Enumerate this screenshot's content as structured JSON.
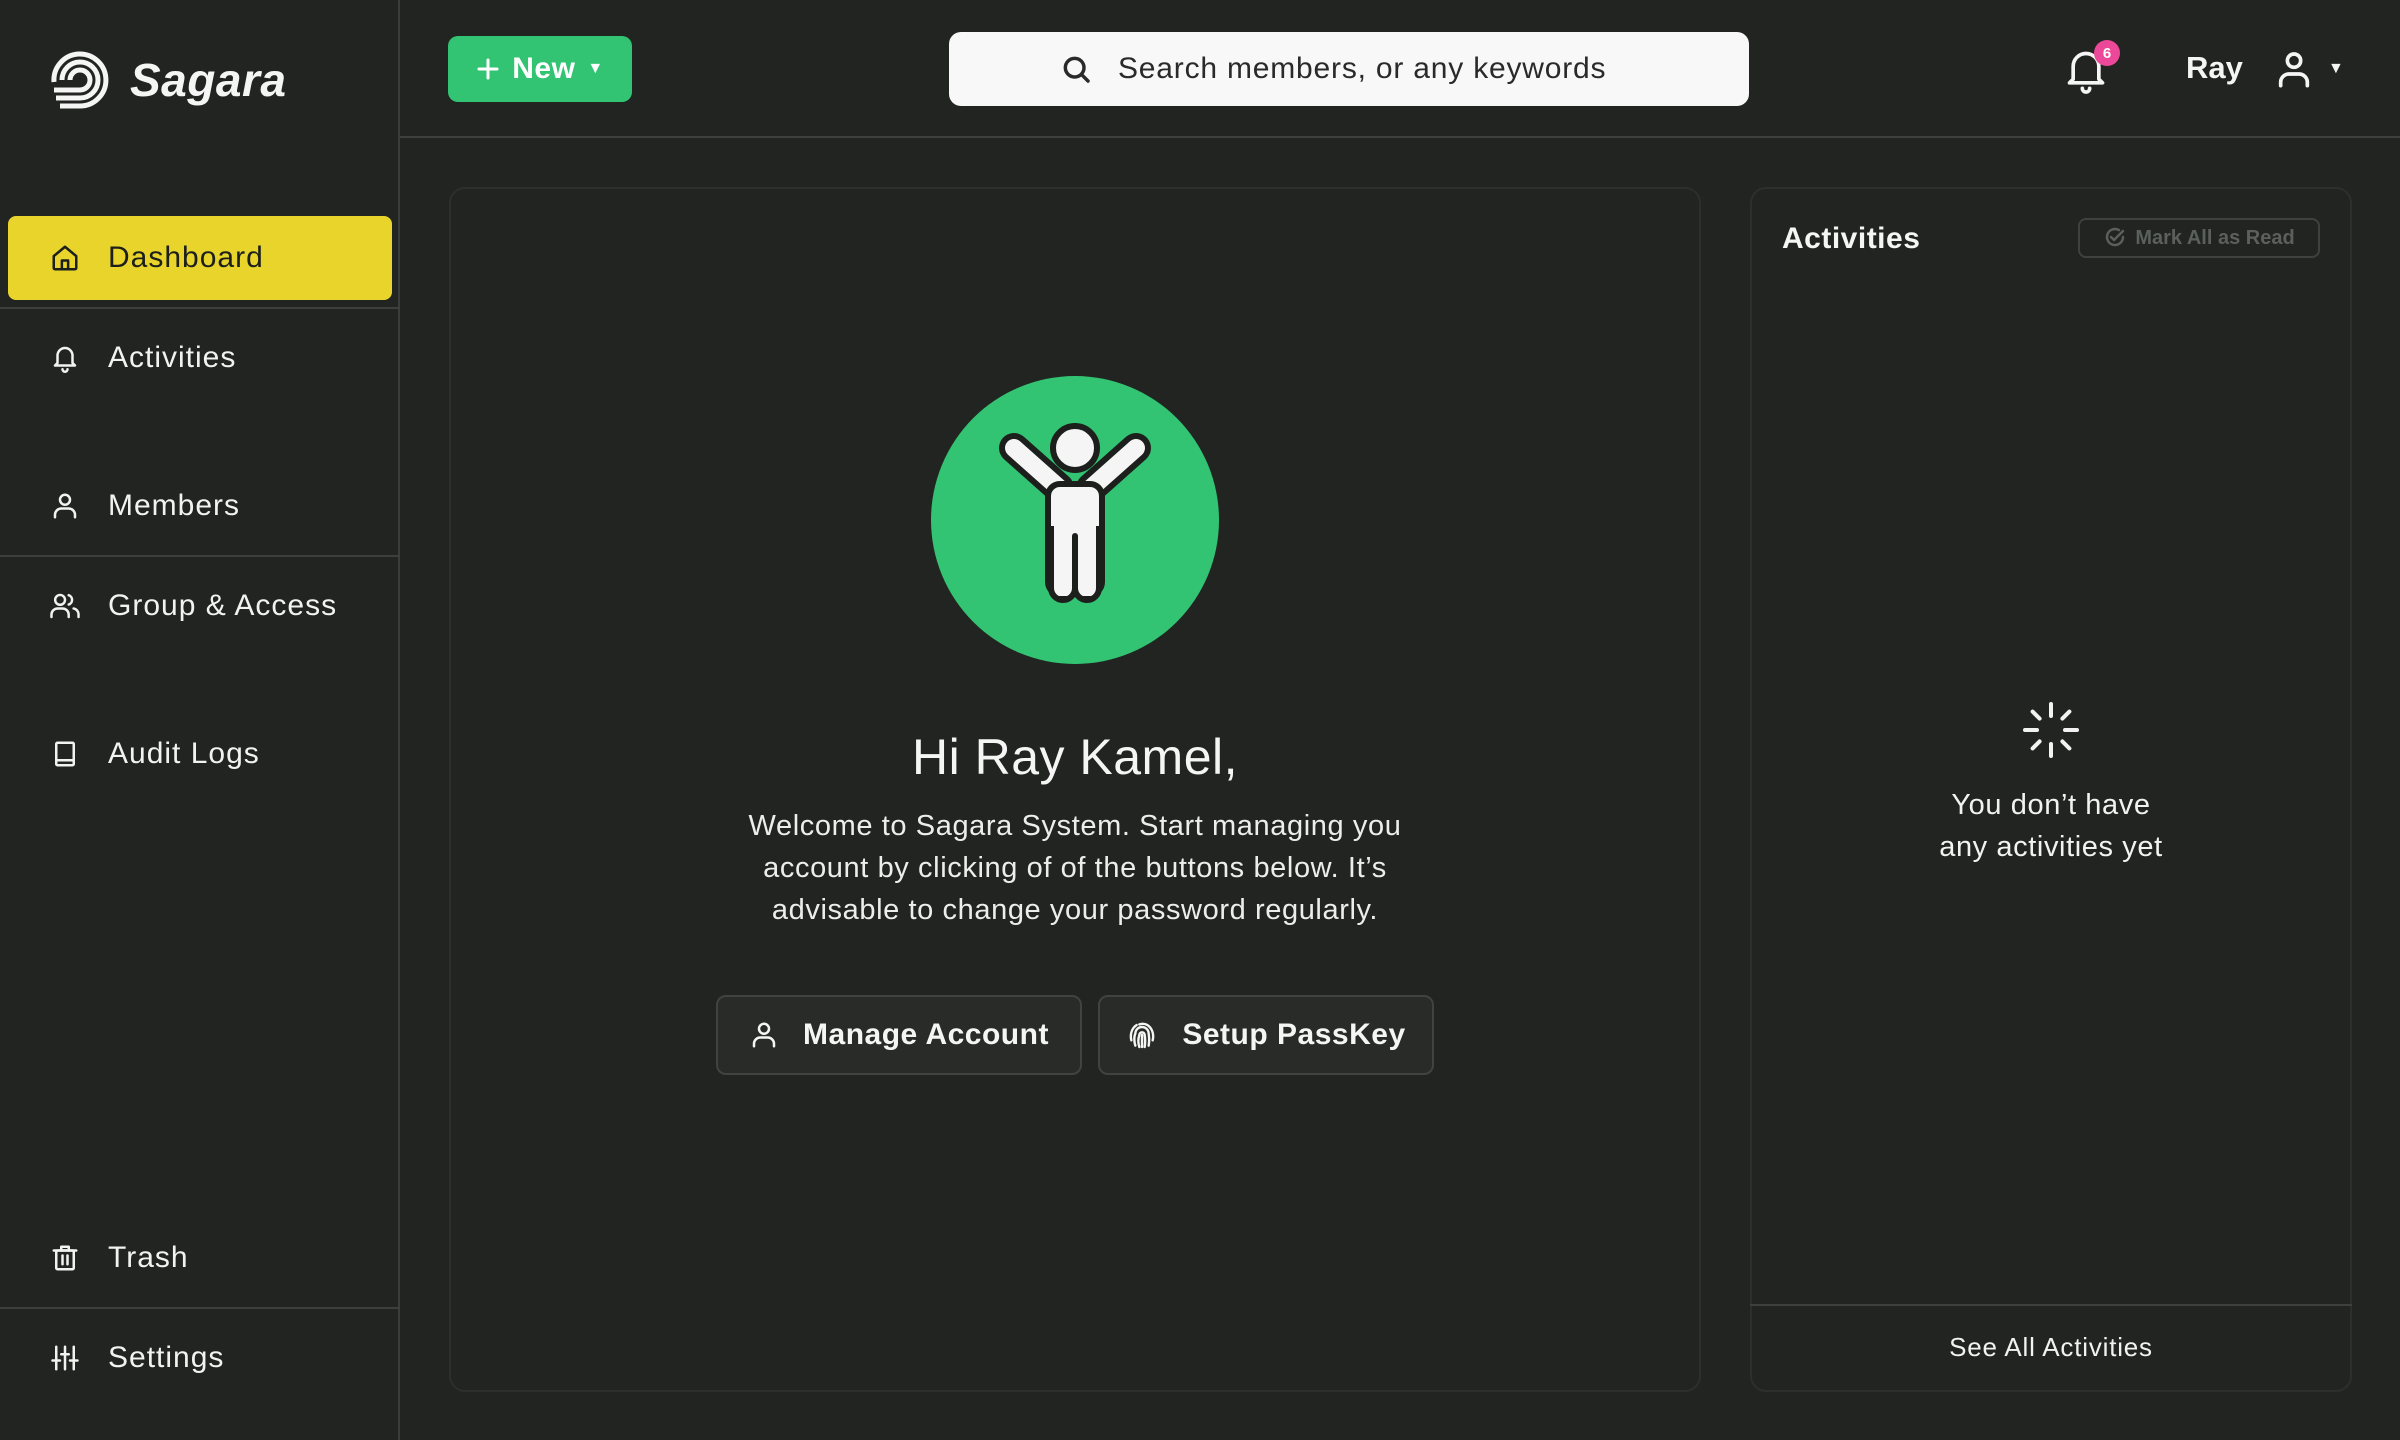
{
  "app": {
    "name": "Sagara"
  },
  "sidebar": {
    "items": [
      {
        "label": "Dashboard",
        "icon": "home-icon",
        "active": true
      },
      {
        "label": "Activities",
        "icon": "bell-icon",
        "active": false
      },
      {
        "label": "Members",
        "icon": "user-icon",
        "active": false
      },
      {
        "label": "Group & Access",
        "icon": "users-icon",
        "active": false
      },
      {
        "label": "Audit Logs",
        "icon": "book-icon",
        "active": false
      },
      {
        "label": "Trash",
        "icon": "trash-icon",
        "active": false
      },
      {
        "label": "Settings",
        "icon": "sliders-icon",
        "active": false
      }
    ]
  },
  "header": {
    "new_button": "New",
    "search_placeholder": "Search members, or any keywords",
    "search_value": "",
    "notification_count": "6",
    "user_name": "Ray"
  },
  "main": {
    "greeting": "Hi Ray Kamel,",
    "welcome": "Welcome to Sagara System. Start managing you account by clicking of of the buttons below. It’s advisable to change your password regularly.",
    "buttons": {
      "manage_account": "Manage Account",
      "setup_passkey": "Setup PassKey"
    }
  },
  "activities": {
    "title": "Activities",
    "mark_all_read": "Mark All as Read",
    "empty_line1": "You don’t have",
    "empty_line2": "any activities yet",
    "see_all": "See All Activities"
  },
  "colors": {
    "accent_yellow": "#e8d42a",
    "accent_green": "#33c473",
    "badge_pink": "#ec4899",
    "background": "#212421"
  }
}
